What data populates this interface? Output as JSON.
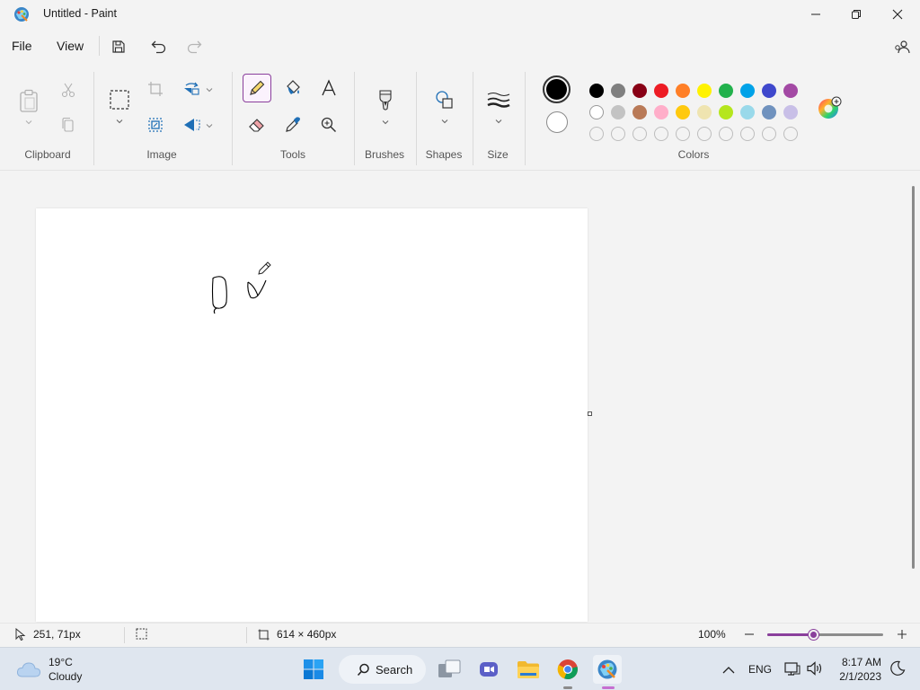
{
  "window": {
    "title": "Untitled - Paint",
    "minimize": "minimize",
    "restore": "restore",
    "close": "close"
  },
  "menu": {
    "file": "File",
    "view": "View"
  },
  "ribbon": {
    "groups": {
      "clipboard": "Clipboard",
      "image": "Image",
      "tools": "Tools",
      "brushes": "Brushes",
      "shapes": "Shapes",
      "size": "Size",
      "colors": "Colors"
    },
    "selected_tool": "pencil",
    "primary_color": "#000000",
    "secondary_color": "#ffffff",
    "palette_row1": [
      "#000000",
      "#7f7f7f",
      "#880015",
      "#ed1c24",
      "#ff7f27",
      "#fff200",
      "#22b14c",
      "#00a2e8",
      "#3f48cc",
      "#a349a4"
    ],
    "palette_row2": [
      "#ffffff",
      "#c3c3c3",
      "#b97a57",
      "#ffaec9",
      "#ffc90e",
      "#efe4b0",
      "#b5e61d",
      "#99d9ea",
      "#7092be",
      "#c8bfe7"
    ],
    "palette_row3_count": 10,
    "accent": "#8a3f9c"
  },
  "status": {
    "cursor_pos": "251, 71px",
    "canvas_size": "614 × 460px",
    "zoom": "100%",
    "zoom_fraction": 0.4
  },
  "taskbar": {
    "temperature": "19°C",
    "condition": "Cloudy",
    "search": "Search",
    "language": "ENG",
    "time": "8:17 AM",
    "date": "2/1/2023"
  }
}
